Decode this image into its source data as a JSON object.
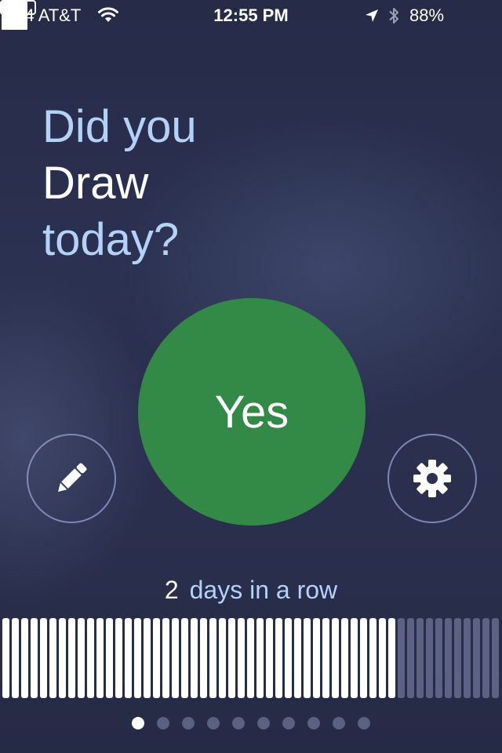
{
  "status_bar": {
    "carrier": "-64 AT&T",
    "time": "12:55 PM",
    "battery_percent": "88%",
    "battery_level": 0.88
  },
  "question": {
    "line1": "Did you",
    "line2": "Draw",
    "line3": "today?"
  },
  "yes_button": {
    "label": "Yes",
    "color": "#328a46"
  },
  "draw_button": {
    "icon": "pencil-icon"
  },
  "settings_button": {
    "icon": "gear-icon"
  },
  "streak": {
    "count": "2",
    "text": "days in a row"
  },
  "streak_history": {
    "filled_days": 42,
    "empty_days": 11
  },
  "pagination": {
    "total": 10,
    "active_index": 0
  },
  "colors": {
    "accent_text": "#b4d2f8",
    "background": "#2a2f4d",
    "bar_filled": "#ffffff",
    "bar_empty": "#5b6283"
  }
}
